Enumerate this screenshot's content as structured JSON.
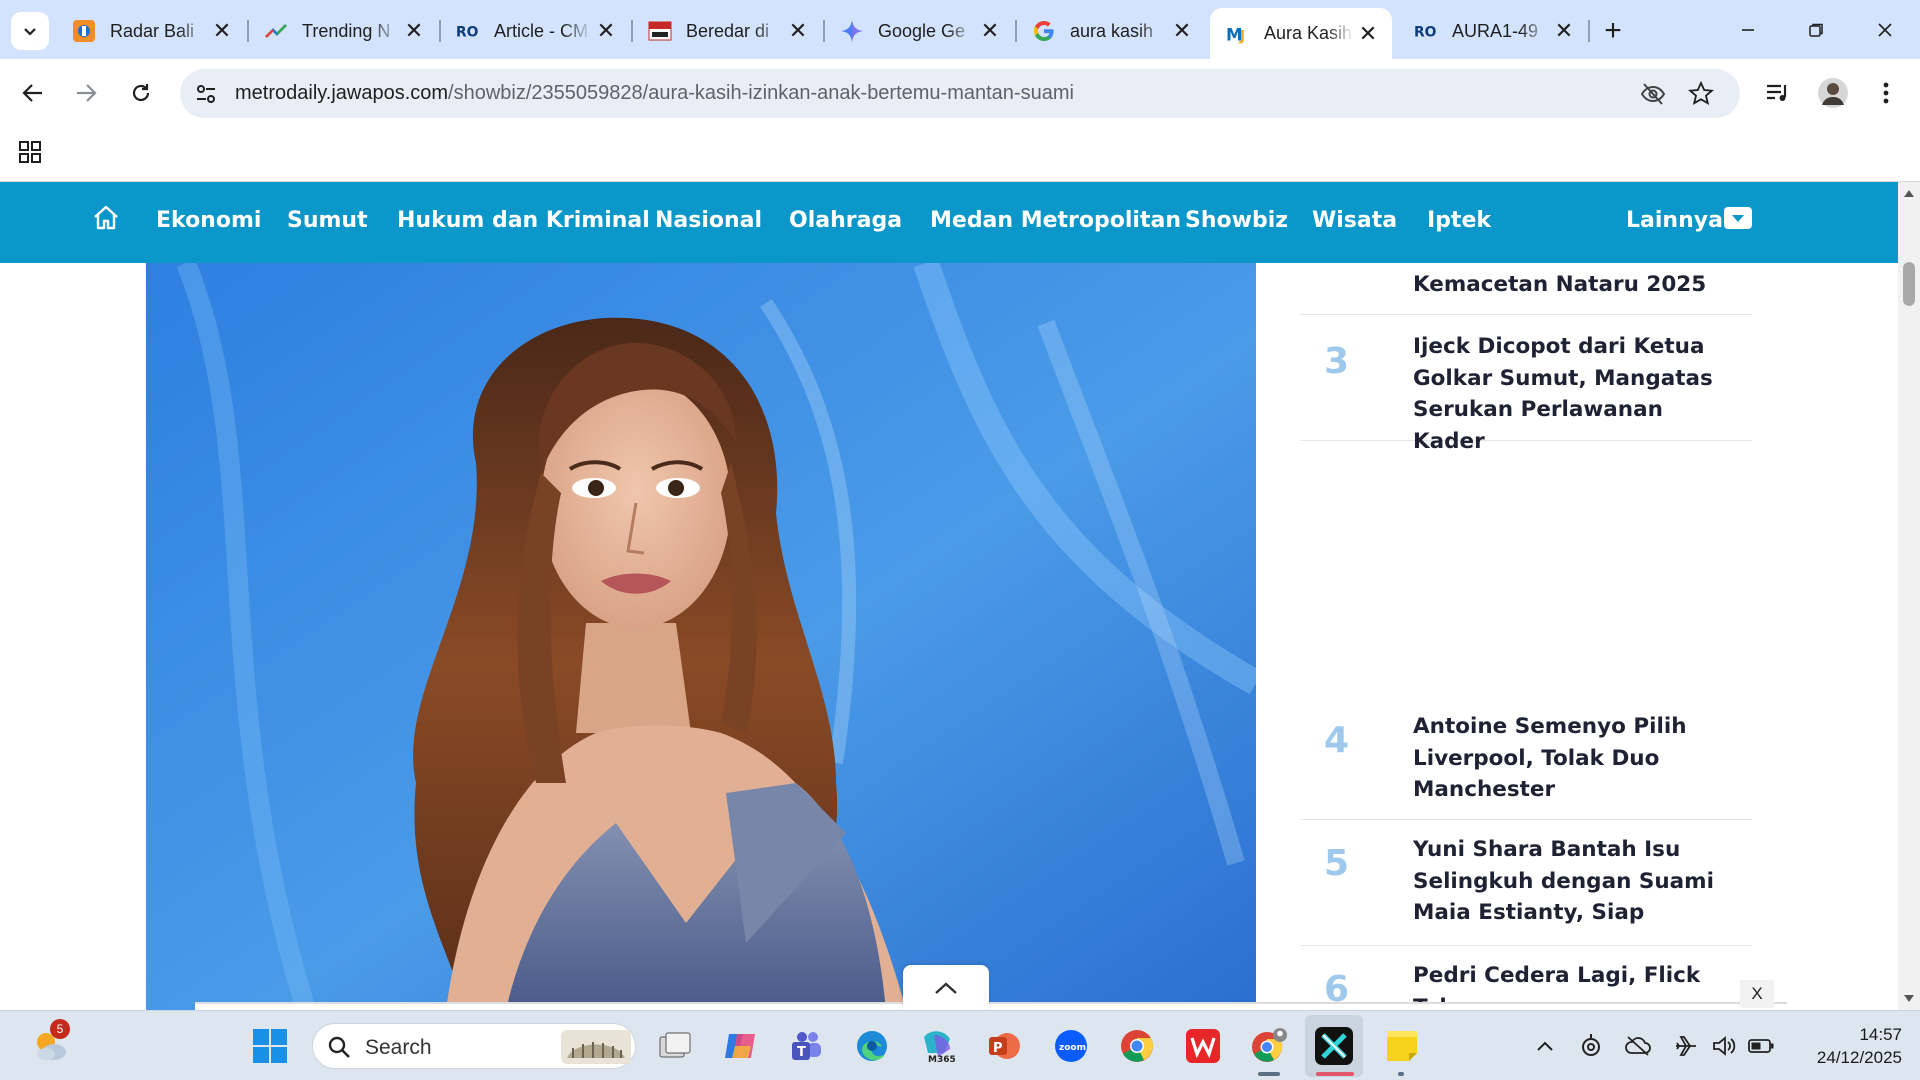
{
  "browser": {
    "tabs": [
      {
        "title": "Radar Bali",
        "icon": "radar-bali-favicon"
      },
      {
        "title": "Trending N",
        "icon": "trending-favicon"
      },
      {
        "title": "Article - CM",
        "icon": "ro-favicon"
      },
      {
        "title": "Beredar di",
        "icon": "berita-satu-favicon"
      },
      {
        "title": "Google Ge",
        "icon": "gemini-favicon"
      },
      {
        "title": "aura kasih",
        "icon": "google-favicon"
      },
      {
        "title": "Aura Kasih",
        "icon": "metrodaily-favicon",
        "active": true
      },
      {
        "title": "AURA1-49",
        "icon": "ro-favicon"
      }
    ],
    "url_host": "metrodaily.jawapos.com",
    "url_path": "/showbiz/2355059828/aura-kasih-izinkan-anak-bertemu-mantan-suami"
  },
  "site": {
    "nav": [
      "Ekonomi",
      "Sumut",
      "Hukum dan Kriminal",
      "Nasional",
      "Olahraga",
      "Medan Metropolitan",
      "Showbiz",
      "Wisata",
      "Iptek"
    ],
    "more_label": "Lainnya"
  },
  "popular": {
    "partial_top_line": "Kemacetan Nataru 2025",
    "items": [
      {
        "num": "3",
        "title": "Ijeck Dicopot dari Ketua Golkar Sumut, Mangatas Serukan Perlawanan Kader"
      },
      {
        "num": "4",
        "title": "Antoine Semenyo Pilih Liverpool, Tolak Duo Manchester"
      },
      {
        "num": "5",
        "title": "Yuni Shara Bantah Isu Selingkuh dengan Suami Maia Estianty, Siap Tempuh..."
      },
      {
        "num": "6",
        "title": "Pedri Cedera Lagi, Flick Tak"
      }
    ]
  },
  "ad": {
    "close_label": "X"
  },
  "taskbar": {
    "weather_badge": "5",
    "search_placeholder": "Search",
    "time": "14:57",
    "date": "24/12/2025"
  },
  "colors": {
    "tabstrip": "#d3e3fd",
    "site_nav": "#0b97c9",
    "rank_number": "#9ec9ec",
    "headline": "#1f2233"
  }
}
